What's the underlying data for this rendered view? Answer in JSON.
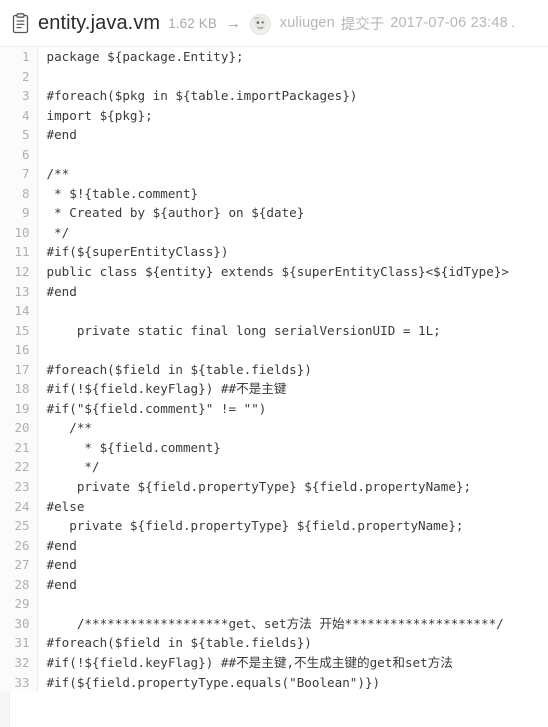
{
  "header": {
    "file_icon": "document-lines-icon",
    "file_name": "entity.java.vm",
    "file_size": "1.62 KB",
    "separator": "→",
    "avatar_icon": "user-avatar-image",
    "committer": "xuliugen",
    "commit_verb": "提交于",
    "commit_date": "2017-07-06 23:48",
    "commit_tail": "."
  },
  "code": {
    "language": "velocity",
    "first_line_number": 1,
    "last_line_number": 33,
    "lines": [
      {
        "n": "1",
        "text": "package ${package.Entity};"
      },
      {
        "n": "2",
        "text": ""
      },
      {
        "n": "3",
        "text": "#foreach($pkg in ${table.importPackages})"
      },
      {
        "n": "4",
        "text": "import ${pkg};"
      },
      {
        "n": "5",
        "text": "#end"
      },
      {
        "n": "6",
        "text": ""
      },
      {
        "n": "7",
        "text": "/**"
      },
      {
        "n": "8",
        "text": " * $!{table.comment}"
      },
      {
        "n": "9",
        "text": " * Created by ${author} on ${date}"
      },
      {
        "n": "10",
        "text": " */"
      },
      {
        "n": "11",
        "text": "#if(${superEntityClass})"
      },
      {
        "n": "12",
        "text": "public class ${entity} extends ${superEntityClass}<${idType}>"
      },
      {
        "n": "13",
        "text": "#end"
      },
      {
        "n": "14",
        "text": ""
      },
      {
        "n": "15",
        "text": "    private static final long serialVersionUID = 1L;"
      },
      {
        "n": "16",
        "text": ""
      },
      {
        "n": "17",
        "text": "#foreach($field in ${table.fields})"
      },
      {
        "n": "18",
        "text": "#if(!${field.keyFlag}) ##不是主键"
      },
      {
        "n": "19",
        "text": "#if(\"${field.comment}\" != \"\")"
      },
      {
        "n": "20",
        "text": "   /**"
      },
      {
        "n": "21",
        "text": "     * ${field.comment}"
      },
      {
        "n": "22",
        "text": "     */"
      },
      {
        "n": "23",
        "text": "    private ${field.propertyType} ${field.propertyName};"
      },
      {
        "n": "24",
        "text": "#else"
      },
      {
        "n": "25",
        "text": "   private ${field.propertyType} ${field.propertyName};"
      },
      {
        "n": "26",
        "text": "#end"
      },
      {
        "n": "27",
        "text": "#end"
      },
      {
        "n": "28",
        "text": "#end"
      },
      {
        "n": "29",
        "text": ""
      },
      {
        "n": "30",
        "text": "    /*******************get、set方法 开始********************/"
      },
      {
        "n": "31",
        "text": "#foreach($field in ${table.fields})"
      },
      {
        "n": "32",
        "text": "#if(!${field.keyFlag}) ##不是主键,不生成主键的get和set方法"
      },
      {
        "n": "33",
        "text": "#if(${field.propertyType.equals(\"Boolean\")})"
      }
    ]
  },
  "colors": {
    "code_text": "#3a3a3a",
    "line_number": "#b0b0b0",
    "gutter_bg": "#fbfbfb",
    "gutter_band": "#f6f6f6",
    "header_meta": "#b4b7bb",
    "file_name": "#2b2b2b",
    "file_size": "#a6a9ad",
    "page_bg": "#ffffff",
    "divider": "#eceef0"
  }
}
